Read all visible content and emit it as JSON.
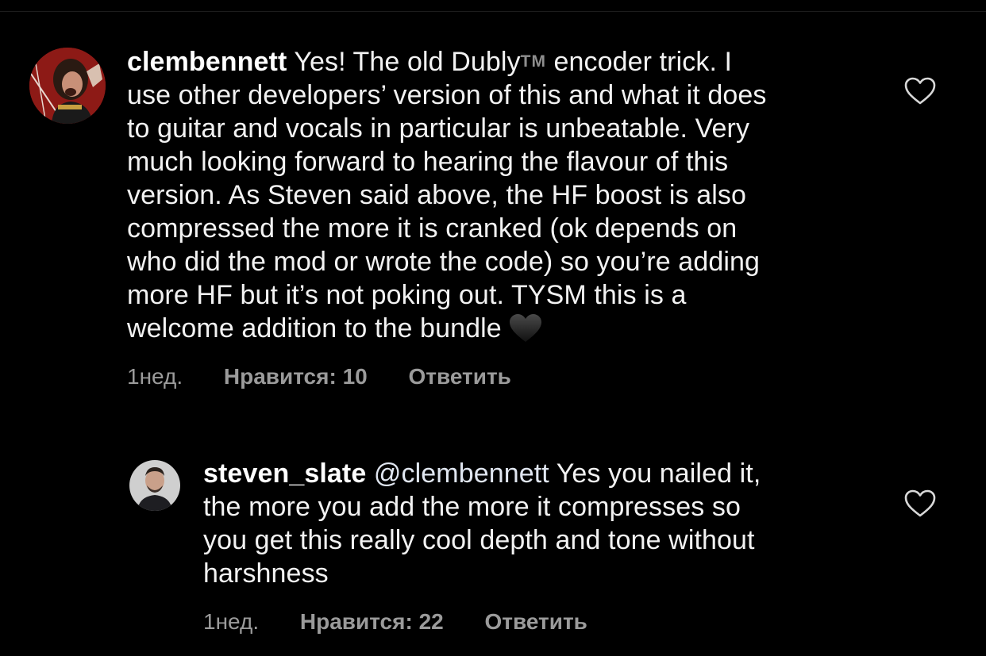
{
  "comments": [
    {
      "username": "clembennett",
      "text_before_tm": "Yes! The old Dubly",
      "tm": "TM",
      "text_line1_rest": " encoder trick. I",
      "lines": [
        "use other developers’ version of this and what it does",
        "to guitar and vocals in particular is unbeatable. Very",
        "much looking forward to hearing the flavour of this",
        "version. As Steven said above, the HF boost is also",
        "compressed the more it is cranked (ok depends on",
        "who did the mod or wrote the code) so you’re adding",
        "more HF but it’s not poking out. TYSM this is a",
        "welcome addition to the bundle"
      ],
      "emoji": "black-heart",
      "time": "1нед.",
      "likes": "Нравится: 10",
      "reply": "Ответить",
      "avatar": "profile-photo-man-with-long-hair"
    },
    {
      "username": "steven_slate",
      "mention": "@clembennett",
      "line1_rest": " Yes you nailed it,",
      "lines": [
        "the more you add the more it compresses so",
        "you get this really cool depth and tone without",
        "harshness"
      ],
      "time": "1нед.",
      "likes": "Нравится: 22",
      "reply": "Ответить",
      "avatar": "profile-photo-man-short-hair"
    }
  ],
  "icons": {
    "like": "heart-outline-icon"
  },
  "colors": {
    "background": "#000000",
    "text": "#f2f2f2",
    "meta": "#9b9b9b"
  }
}
